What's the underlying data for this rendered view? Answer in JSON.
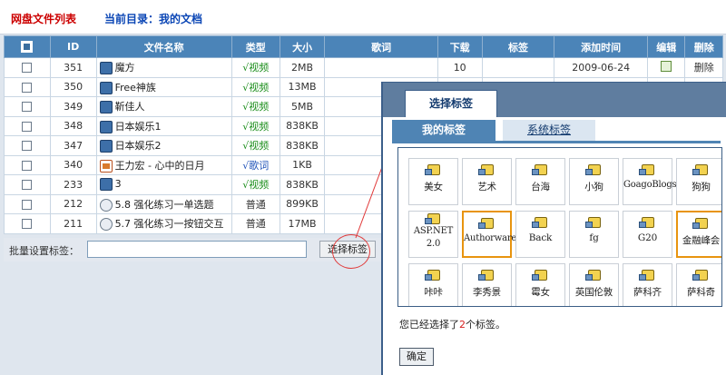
{
  "header": {
    "left_title": "网盘文件列表",
    "right_title": "当前目录：我的文档"
  },
  "table": {
    "headers": [
      "ID",
      "文件名称",
      "类型",
      "大小",
      "歌词",
      "下载",
      "标签",
      "添加时间",
      "编辑",
      "删除"
    ],
    "rows": [
      {
        "id": "351",
        "name": "魔方",
        "icon": "video-icon",
        "type": "√视频",
        "size": "2MB",
        "lyric": "",
        "download": "10",
        "tag": "",
        "date": "2009-06-24",
        "edit": "edit-icon",
        "delete": "删除"
      },
      {
        "id": "350",
        "name": "Free神族",
        "icon": "video-icon",
        "type": "√视频",
        "size": "13MB"
      },
      {
        "id": "349",
        "name": "靳佳人",
        "icon": "video-icon",
        "type": "√视频",
        "size": "5MB"
      },
      {
        "id": "348",
        "name": "日本娱乐1",
        "icon": "video-icon",
        "type": "√视频",
        "size": "838KB"
      },
      {
        "id": "347",
        "name": "日本娱乐2",
        "icon": "video-icon",
        "type": "√视频",
        "size": "838KB"
      },
      {
        "id": "340",
        "name": "王力宏 - 心中的日月",
        "icon": "lyric-icon",
        "type": "√歌词",
        "size": "1KB"
      },
      {
        "id": "233",
        "name": "3",
        "icon": "video-icon",
        "type": "√视频",
        "size": "838KB"
      },
      {
        "id": "212",
        "name": "5.8 强化练习一单选题",
        "icon": "document-icon",
        "type": "普通",
        "size": "899KB"
      },
      {
        "id": "211",
        "name": "5.7 强化练习一按钮交互",
        "icon": "document-icon",
        "type": "普通",
        "size": "17MB"
      }
    ]
  },
  "batch": {
    "label": "批量设置标签：",
    "input_value": "",
    "button": "选择标签"
  },
  "dialog": {
    "title_tab": "选择标签",
    "tabs": {
      "mine": "我的标签",
      "system": "系统标签"
    },
    "tags": [
      {
        "label": "美女",
        "selected": false
      },
      {
        "label": "艺术",
        "selected": false
      },
      {
        "label": "台海",
        "selected": false
      },
      {
        "label": "小狗",
        "selected": false
      },
      {
        "label": "GoagoBlogs",
        "selected": false
      },
      {
        "label": "狗狗",
        "selected": false
      },
      {
        "label": "ASP.NET 2.0",
        "selected": false
      },
      {
        "label": "Authorware",
        "selected": true
      },
      {
        "label": "Back",
        "selected": false
      },
      {
        "label": "fg",
        "selected": false
      },
      {
        "label": "G20",
        "selected": false
      },
      {
        "label": "金融峰会",
        "selected": true
      },
      {
        "label": "咔咔",
        "selected": false
      },
      {
        "label": "李秀景",
        "selected": false
      },
      {
        "label": "霉女",
        "selected": false
      },
      {
        "label": "英国伦敦",
        "selected": false
      },
      {
        "label": "萨科齐",
        "selected": false
      },
      {
        "label": "萨科奇",
        "selected": false
      }
    ],
    "status_prefix": "您已经选择了",
    "status_count": "2",
    "status_suffix": "个标签。",
    "ok": "确定"
  },
  "colors": {
    "header_blue": "#4b84b8",
    "highlight": "#e8940f",
    "annotation_red": "#e13a3a"
  }
}
